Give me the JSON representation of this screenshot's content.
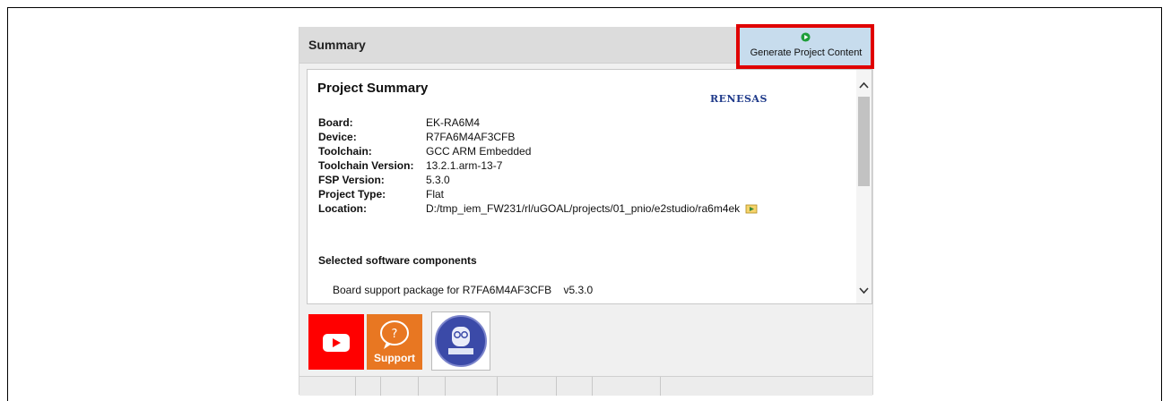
{
  "header": {
    "title": "Summary",
    "generate_button_label": "Generate Project Content"
  },
  "summary": {
    "title": "Project Summary",
    "logo_text": "RENESAS",
    "rows": [
      {
        "label": "Board:",
        "value": "EK-RA6M4"
      },
      {
        "label": "Device:",
        "value": "R7FA6M4AF3CFB"
      },
      {
        "label": "Toolchain:",
        "value": "GCC ARM Embedded"
      },
      {
        "label": "Toolchain Version:",
        "value": "13.2.1.arm-13-7"
      },
      {
        "label": "FSP Version:",
        "value": "5.3.0"
      },
      {
        "label": "Project Type:",
        "value": "Flat"
      },
      {
        "label": "Location:",
        "value": "D:/tmp_iem_FW231/rl/uGOAL/projects/01_pnio/e2studio/ra6m4ek"
      }
    ],
    "components_title": "Selected software components",
    "components": [
      {
        "name": "Board support package for R7FA6M4AF3CFB",
        "version": "v5.3.0"
      }
    ]
  },
  "quick_links": {
    "support_label": "Support"
  },
  "colors": {
    "highlight": "#e00000",
    "generate_button_bg": "#c7dced",
    "play_green": "#1e9e3a",
    "youtube_red": "#ff0000",
    "support_orange": "#e87722"
  },
  "icons": {
    "generate": "play-circle-icon",
    "location": "open-folder-arrow-icon",
    "youtube": "youtube-icon",
    "support": "support-chat-icon",
    "manual": "owl-book-icon"
  }
}
